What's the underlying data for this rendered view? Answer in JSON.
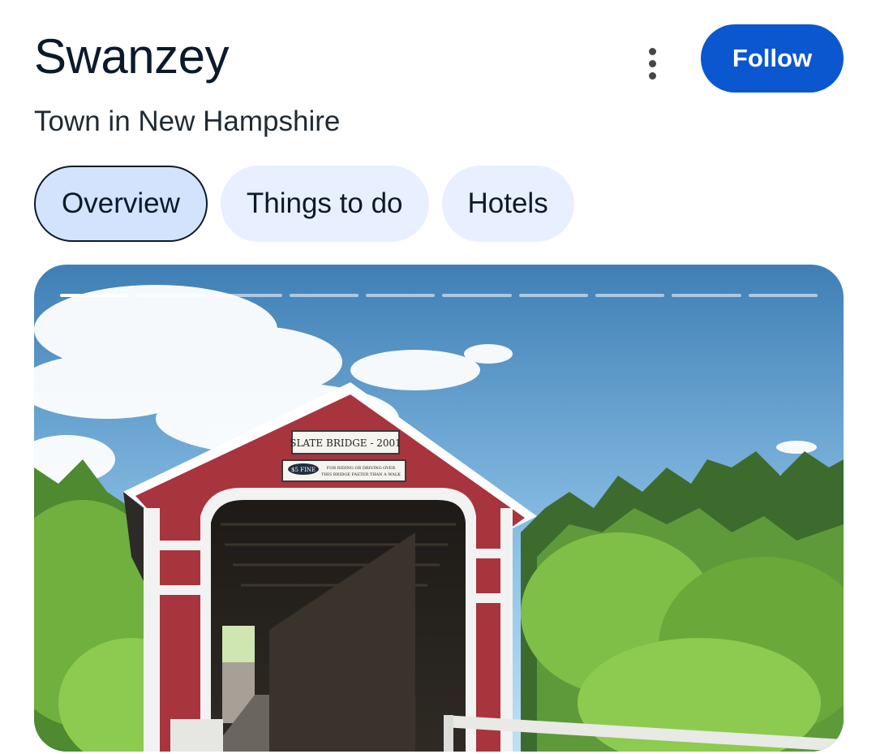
{
  "header": {
    "title": "Swanzey",
    "subtitle": "Town in New Hampshire",
    "follow_label": "Follow",
    "more_icon": "more-vert-icon"
  },
  "tabs": [
    {
      "label": "Overview",
      "active": true
    },
    {
      "label": "Things to do",
      "active": false
    },
    {
      "label": "Hotels",
      "active": false
    }
  ],
  "gallery": {
    "slide_count": 10,
    "active_index": 0,
    "image_signs": {
      "bridge_name": "SLATE BRIDGE - 2001",
      "fine": "$5 FINE",
      "fine_text_1": "FOR RIDING OR DRIVING OVER",
      "fine_text_2": "THIS BRIDGE FASTER THAN A WALK"
    }
  },
  "colors": {
    "accent": "#0b57d0",
    "chip_bg": "#e8efff",
    "chip_active_bg": "#d3e3fd",
    "bridge_red": "#a8343d"
  }
}
